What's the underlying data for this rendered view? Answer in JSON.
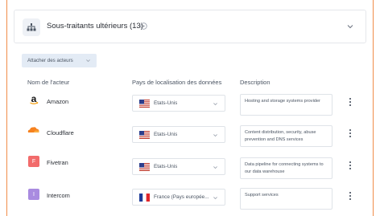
{
  "header": {
    "title": "Sous-traitants ultérieurs (13)",
    "icon": "sitemap-icon",
    "help_icon": "help-circle-icon",
    "toggle_icon": "chevron-down-icon"
  },
  "toolbar": {
    "attach_label": "Attacher des acteurs"
  },
  "columns": {
    "actor": "Nom de l'acteur",
    "country": "Pays de localisation des données",
    "description": "Description"
  },
  "rows": [
    {
      "name": "Amazon",
      "logo": "amazon-logo",
      "country": "États-Unis",
      "flag": "us-flag",
      "description": "Hosting and storage systems provider"
    },
    {
      "name": "Cloudflare",
      "logo": "cloudflare-logo",
      "country": "États-Unis",
      "flag": "us-flag",
      "description": "Content distribution, security, abuse prevention and DNS services"
    },
    {
      "name": "Fivetran",
      "logo": "fivetran-logo",
      "logo_letter": "F",
      "logo_color": "#f26b6b",
      "country": "États-Unis",
      "flag": "us-flag",
      "description": "Data pipeline for connecting systems to our data warehouse"
    },
    {
      "name": "Intercom",
      "logo": "intercom-logo",
      "logo_letter": "I",
      "logo_color": "#a98be0",
      "country": "France (Pays européen)",
      "country_display": "France (Pays européе...",
      "flag": "fr-flag",
      "description": "Support services"
    }
  ],
  "colors": {
    "accent_border": "#f08c4a",
    "button_bg": "#e3ebf5"
  }
}
